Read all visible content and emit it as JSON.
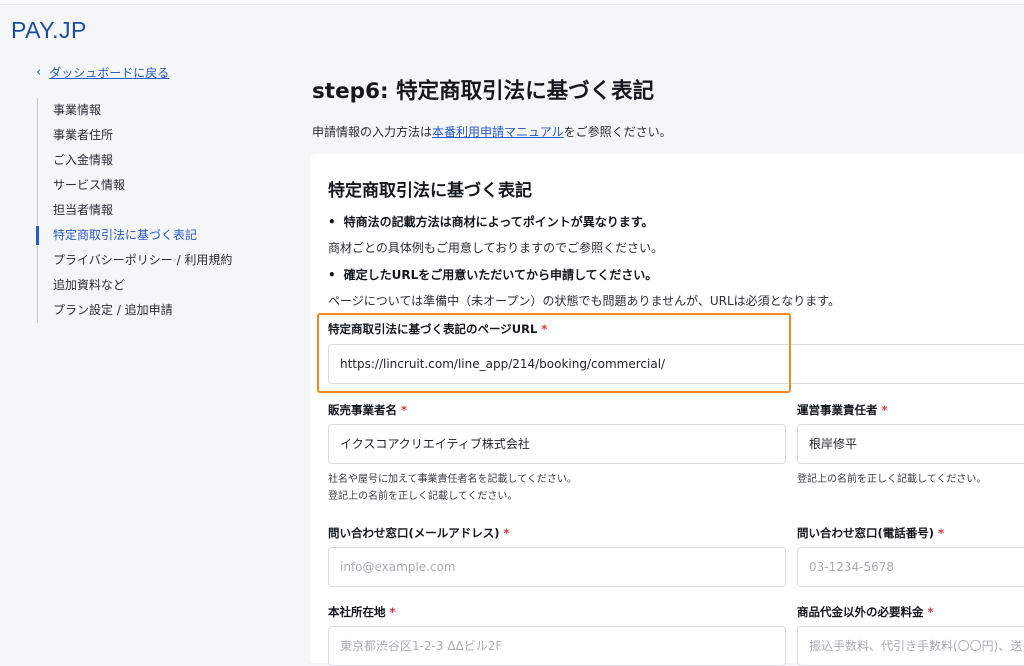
{
  "brand": {
    "logo_text": "PAY.JP"
  },
  "nav": {
    "back_label": "ダッシュボードに戻る",
    "items": [
      {
        "label": "事業情報"
      },
      {
        "label": "事業者住所"
      },
      {
        "label": "ご入金情報"
      },
      {
        "label": "サービス情報"
      },
      {
        "label": "担当者情報"
      },
      {
        "label": "特定商取引法に基づく表記",
        "active": true
      },
      {
        "label": "プライバシーポリシー / 利用規約"
      },
      {
        "label": "追加資料など"
      },
      {
        "label": "プラン設定 / 追加申請"
      }
    ]
  },
  "main": {
    "title": "step6: 特定商取引法に基づく表記",
    "intro_prefix": "申請情報の入力方法は",
    "intro_link": "本番利用申請マニュアル",
    "intro_suffix": "をご参照ください。"
  },
  "card": {
    "title": "特定商取引法に基づく表記",
    "bullet1": "特商法の記載方法は商材によってポイントが異なります。",
    "note1": "商材ごとの具体例もご用意しておりますのでご参照ください。",
    "bullet2": "確定したURLをご用意いただいてから申請してください。",
    "note2": "ページについては準備中（未オープン）の状態でも問題ありませんが、URLは必須となります。"
  },
  "form": {
    "required_mark": "*",
    "url": {
      "label": "特定商取引法に基づく表記のページURL",
      "value": "https://lincruit.com/line_app/214/booking/commercial/"
    },
    "seller": {
      "label": "販売事業者名",
      "value": "イクスコアクリエイティブ株式会社",
      "help1": "社名や屋号に加えて事業責任者名を記載してください。",
      "help2": "登記上の名前を正しく記載してください。"
    },
    "manager": {
      "label": "運営事業責任者",
      "value": "根岸修平",
      "help1": "登記上の名前を正しく記載してください。"
    },
    "email": {
      "label": "問い合わせ窓口(メールアドレス)",
      "placeholder": "info@example.com"
    },
    "phone": {
      "label": "問い合わせ窓口(電話番号)",
      "placeholder": "03-1234-5678"
    },
    "address": {
      "label": "本社所在地",
      "placeholder": "東京都渋谷区1-2-3 ΔΔビル2F"
    },
    "fees": {
      "label": "商品代金以外の必要料金",
      "placeholder": "振込手数料、代引き手数料(〇〇円)、送"
    }
  },
  "colors": {
    "accent": "#2a59c9",
    "required": "#e0343c",
    "highlight": "#f08a1f",
    "brand": "#1d4e9e"
  }
}
